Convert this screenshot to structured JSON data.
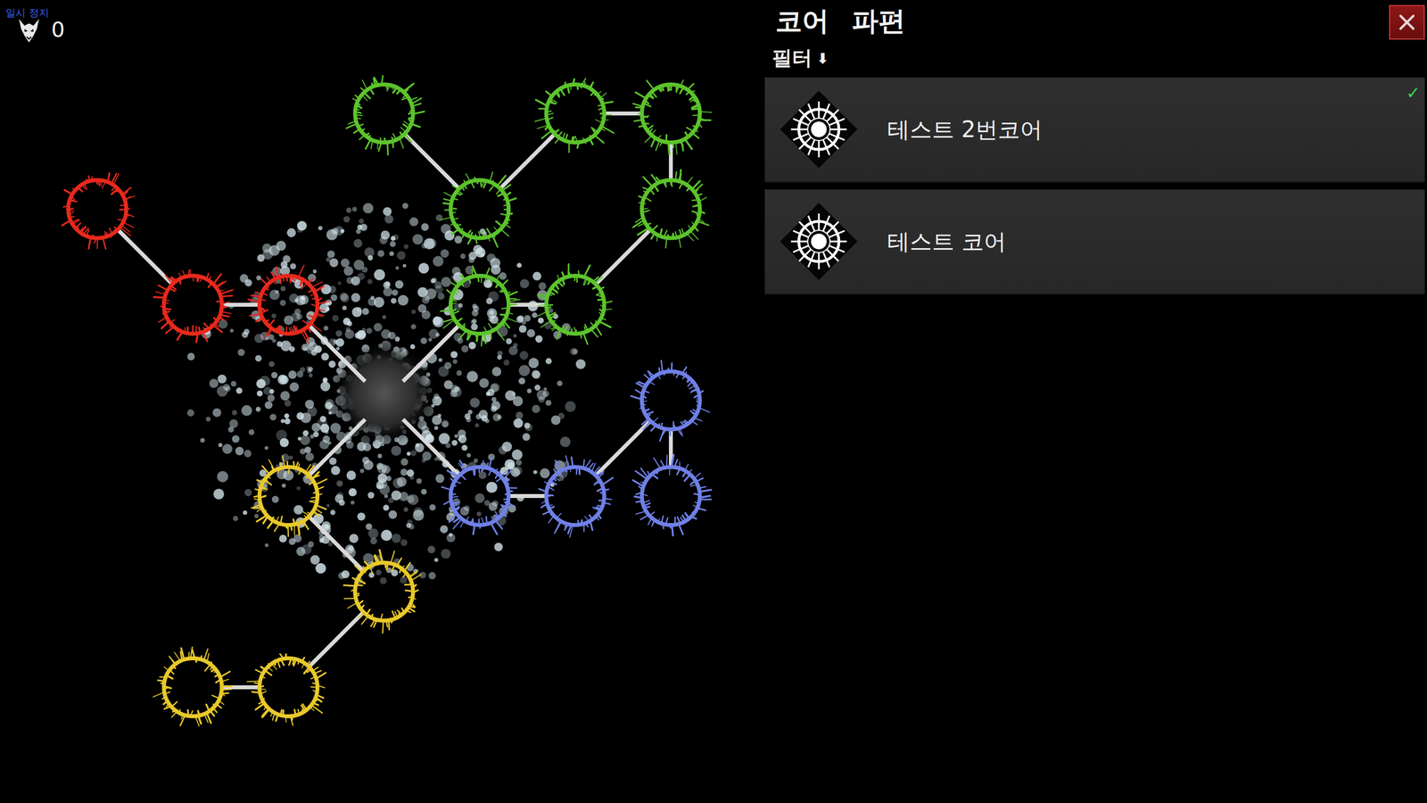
{
  "hud": {
    "status": "일시 정지",
    "currency": "0"
  },
  "panel": {
    "title": "코어 파편",
    "filter": {
      "label": "필터",
      "icon": "⬇"
    },
    "items": [
      {
        "name": "테스트 2번코어",
        "selected": true
      },
      {
        "name": "테스트 코어",
        "selected": false
      }
    ]
  },
  "tree": {
    "nodes": [
      {
        "kind": "core",
        "cell": [
          0,
          0
        ]
      },
      {
        "kind": "skill",
        "cell": [
          -1,
          -1
        ],
        "color": "#e8291c"
      },
      {
        "kind": "skill",
        "cell": [
          -2,
          -1
        ],
        "color": "#e8291c"
      },
      {
        "kind": "skill",
        "cell": [
          -3,
          -2
        ],
        "color": "#e8291c"
      },
      {
        "kind": "skill",
        "cell": [
          1,
          -1
        ],
        "color": "#5cc42c"
      },
      {
        "kind": "skill",
        "cell": [
          2,
          -1
        ],
        "color": "#5cc42c"
      },
      {
        "kind": "skill",
        "cell": [
          3,
          -2
        ],
        "color": "#5cc42c"
      },
      {
        "kind": "skill",
        "cell": [
          3,
          -3
        ],
        "color": "#5cc42c"
      },
      {
        "kind": "skill",
        "cell": [
          2,
          -3
        ],
        "color": "#5cc42c"
      },
      {
        "kind": "skill",
        "cell": [
          1,
          -2
        ],
        "color": "#5cc42c"
      },
      {
        "kind": "skill",
        "cell": [
          0,
          -3
        ],
        "color": "#5cc42c"
      },
      {
        "kind": "skill",
        "cell": [
          1,
          1
        ],
        "color": "#6f80e6"
      },
      {
        "kind": "skill",
        "cell": [
          2,
          1
        ],
        "color": "#6f80e6"
      },
      {
        "kind": "skill",
        "cell": [
          3,
          0
        ],
        "color": "#6f80e6"
      },
      {
        "kind": "skill",
        "cell": [
          3,
          1
        ],
        "color": "#6f80e6"
      },
      {
        "kind": "skill",
        "cell": [
          -1,
          1
        ],
        "color": "#e9c92b"
      },
      {
        "kind": "skill",
        "cell": [
          0,
          2
        ],
        "color": "#e9c92b"
      },
      {
        "kind": "skill",
        "cell": [
          -1,
          3
        ],
        "color": "#e9c92b"
      },
      {
        "kind": "skill",
        "cell": [
          -2,
          3
        ],
        "color": "#e9c92b"
      }
    ],
    "edges": [
      [
        0,
        1
      ],
      [
        1,
        2
      ],
      [
        2,
        3
      ],
      [
        0,
        4
      ],
      [
        4,
        5
      ],
      [
        5,
        6
      ],
      [
        6,
        7
      ],
      [
        7,
        8
      ],
      [
        8,
        9
      ],
      [
        9,
        10
      ],
      [
        0,
        11
      ],
      [
        11,
        12
      ],
      [
        12,
        13
      ],
      [
        13,
        14
      ],
      [
        0,
        15
      ],
      [
        15,
        16
      ],
      [
        16,
        17
      ],
      [
        17,
        18
      ]
    ]
  }
}
